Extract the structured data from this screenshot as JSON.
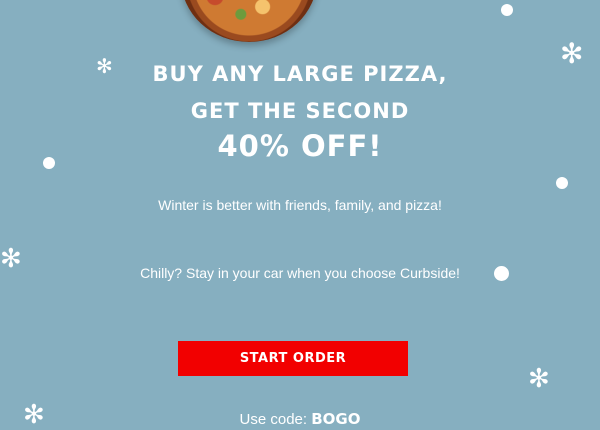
{
  "headline": {
    "line1": "BUY ANY LARGE PIZZA,",
    "line2": "GET THE SECOND",
    "line3": "40% OFF!"
  },
  "paragraphs": {
    "p1": "Winter is better with friends, family, and pizza!",
    "p2": "Chilly? Stay in your car when you choose Curbside!"
  },
  "cta": {
    "label": "START ORDER"
  },
  "promo": {
    "prefix": "Use code:",
    "code": "BOGO"
  },
  "colors": {
    "background": "#86afc0",
    "button": "#f20000",
    "text": "#ffffff"
  },
  "decor": {
    "snowflake_glyph": "✻"
  }
}
